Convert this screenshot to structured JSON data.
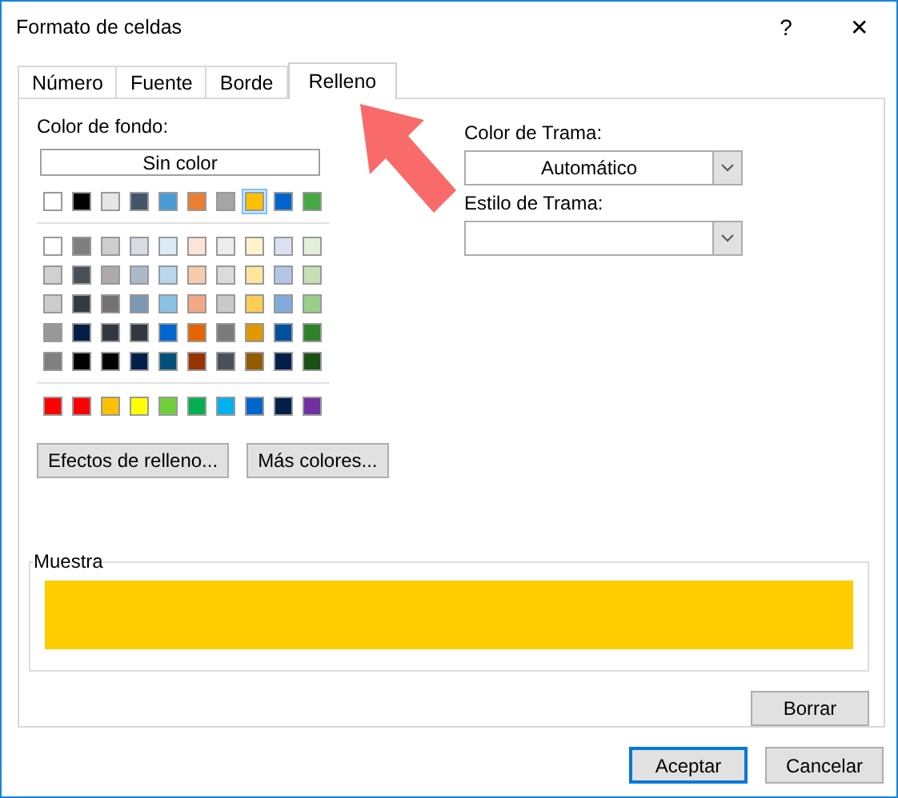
{
  "window": {
    "title": "Formato de celdas",
    "help": "?",
    "close": "✕"
  },
  "tabs": [
    {
      "label": "Número",
      "selected": false
    },
    {
      "label": "Fuente",
      "selected": false
    },
    {
      "label": "Borde",
      "selected": false
    },
    {
      "label": "Relleno",
      "selected": true
    }
  ],
  "background": {
    "label": "Color de fondo:",
    "no_color_button": "Sin color",
    "theme_colors": [
      {
        "color": "#ffffff",
        "selected": false
      },
      {
        "color": "#000000",
        "selected": false
      },
      {
        "color": "#e7e6e6",
        "selected": false
      },
      {
        "color": "#44546a",
        "selected": false
      },
      {
        "color": "#4a9bd4",
        "selected": false
      },
      {
        "color": "#ed7d31",
        "selected": false
      },
      {
        "color": "#a5a5a5",
        "selected": false
      },
      {
        "color": "#ffc000",
        "selected": true
      },
      {
        "color": "#0066cc",
        "selected": false
      },
      {
        "color": "#47a844",
        "selected": false
      }
    ],
    "tint_rows": [
      [
        {
          "color": "#ffffff",
          "selected": false
        },
        {
          "color": "#7f7f7f",
          "selected": false
        },
        {
          "color": "#d0cece",
          "selected": false
        },
        {
          "color": "#d6dce4",
          "selected": false
        },
        {
          "color": "#ddebf7",
          "selected": false
        },
        {
          "color": "#fce4d6",
          "selected": false
        },
        {
          "color": "#ededed",
          "selected": false
        },
        {
          "color": "#fff2cc",
          "selected": false
        },
        {
          "color": "#d9e1f2",
          "selected": false
        },
        {
          "color": "#e2efda",
          "selected": false
        }
      ],
      [
        {
          "color": "#d0d0d0",
          "selected": false
        },
        {
          "color": "#4a5058",
          "selected": false
        },
        {
          "color": "#aeaaaa",
          "selected": false
        },
        {
          "color": "#acb9ca",
          "selected": false
        },
        {
          "color": "#b7d7ee",
          "selected": false
        },
        {
          "color": "#f8cbad",
          "selected": false
        },
        {
          "color": "#dbdbdb",
          "selected": false
        },
        {
          "color": "#ffe699",
          "selected": false
        },
        {
          "color": "#b4c6e7",
          "selected": false
        },
        {
          "color": "#c6e0b4",
          "selected": false
        }
      ],
      [
        {
          "color": "#cccccc",
          "selected": false
        },
        {
          "color": "#353a40",
          "selected": false
        },
        {
          "color": "#757171",
          "selected": false
        },
        {
          "color": "#7a99b5",
          "selected": false
        },
        {
          "color": "#8ac2e6",
          "selected": false
        },
        {
          "color": "#f4a884",
          "selected": false
        },
        {
          "color": "#c9c9c9",
          "selected": false
        },
        {
          "color": "#ffcc55",
          "selected": false
        },
        {
          "color": "#80acdb",
          "selected": false
        },
        {
          "color": "#98d08a",
          "selected": false
        }
      ],
      [
        {
          "color": "#989898",
          "selected": false
        },
        {
          "color": "#041e4a",
          "selected": false
        },
        {
          "color": "#333840",
          "selected": false
        },
        {
          "color": "#333840",
          "selected": false
        },
        {
          "color": "#0066d0",
          "selected": false
        },
        {
          "color": "#e56400",
          "selected": false
        },
        {
          "color": "#7b7b7b",
          "selected": false
        },
        {
          "color": "#de9800",
          "selected": false
        },
        {
          "color": "#00509e",
          "selected": false
        },
        {
          "color": "#2e8228",
          "selected": false
        }
      ],
      [
        {
          "color": "#808080",
          "selected": false
        },
        {
          "color": "#000000",
          "selected": false
        },
        {
          "color": "#020202",
          "selected": false
        },
        {
          "color": "#041e4a",
          "selected": false
        },
        {
          "color": "#00507a",
          "selected": false
        },
        {
          "color": "#993300",
          "selected": false
        },
        {
          "color": "#4a5058",
          "selected": false
        },
        {
          "color": "#945c00",
          "selected": false
        },
        {
          "color": "#041e4a",
          "selected": false
        },
        {
          "color": "#1b5017",
          "selected": false
        }
      ]
    ],
    "standard_colors": [
      {
        "color": "#ff0000",
        "selected": false
      },
      {
        "color": "#ff0000",
        "selected": false
      },
      {
        "color": "#ffc000",
        "selected": false
      },
      {
        "color": "#ffff00",
        "selected": false
      },
      {
        "color": "#6fcf3c",
        "selected": false
      },
      {
        "color": "#00b050",
        "selected": false
      },
      {
        "color": "#00b0f0",
        "selected": false
      },
      {
        "color": "#0066cc",
        "selected": false
      },
      {
        "color": "#041e4a",
        "selected": false
      },
      {
        "color": "#7030a0",
        "selected": false
      }
    ],
    "buttons": [
      "Efectos de relleno...",
      "Más colores..."
    ]
  },
  "pattern_color": {
    "label": "Color de Trama:",
    "value": "Automático"
  },
  "pattern_style": {
    "label": "Estilo de Trama:"
  },
  "sample": {
    "label": "Muestra",
    "color": "#ffcc00"
  },
  "clear_button": "Borrar",
  "footer_buttons": [
    {
      "label": "Aceptar",
      "default": true
    },
    {
      "label": "Cancelar",
      "default": false
    }
  ]
}
